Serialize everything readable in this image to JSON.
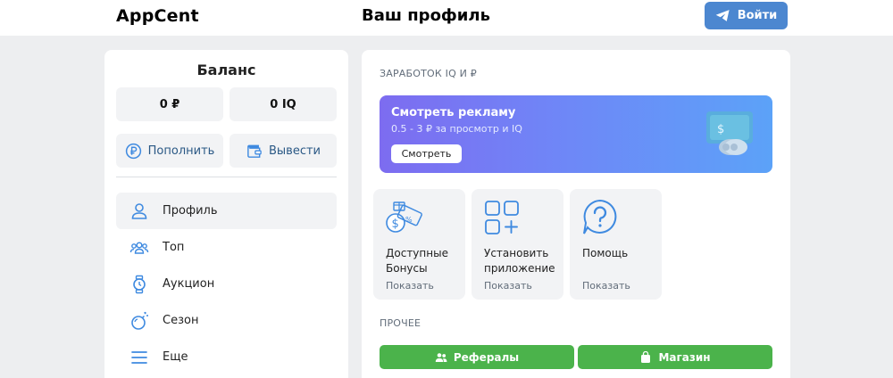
{
  "header": {
    "logo": "AppCent",
    "title": "Ваш профиль",
    "login_label": "Войти"
  },
  "balance": {
    "title": "Баланс",
    "rub": "0 ₽",
    "iq": "0 IQ",
    "topup_label": "Пополнить",
    "withdraw_label": "Вывести"
  },
  "nav": {
    "items": [
      {
        "label": "Профиль",
        "icon": "user-icon"
      },
      {
        "label": "Топ",
        "icon": "users-icon"
      },
      {
        "label": "Аукцион",
        "icon": "watch-icon"
      },
      {
        "label": "Сезон",
        "icon": "bomb-icon"
      },
      {
        "label": "Еще",
        "icon": "menu-icon"
      }
    ]
  },
  "earn": {
    "section_label": "ЗАРАБОТОК IQ И ₽",
    "ad": {
      "title": "Смотреть рекламу",
      "subtitle": "0.5 - 3 ₽ за просмотр и IQ",
      "button": "Смотреть"
    },
    "tiles": [
      {
        "title": "Доступные Бонусы",
        "sub": "Показать",
        "icon": "bonus-coupon-icon"
      },
      {
        "title": "Установить приложение",
        "sub": "Показать",
        "icon": "install-apps-icon"
      },
      {
        "title": "Помощь",
        "sub": "Показать",
        "icon": "help-question-icon"
      }
    ]
  },
  "other": {
    "section_label": "ПРОЧЕЕ",
    "referrals_label": "Рефералы",
    "shop_label": "Магазин"
  },
  "colors": {
    "accent": "#4c87d0",
    "link": "#2a5885",
    "green": "#4bb34b",
    "icon_blue": "#3f8ae0"
  }
}
